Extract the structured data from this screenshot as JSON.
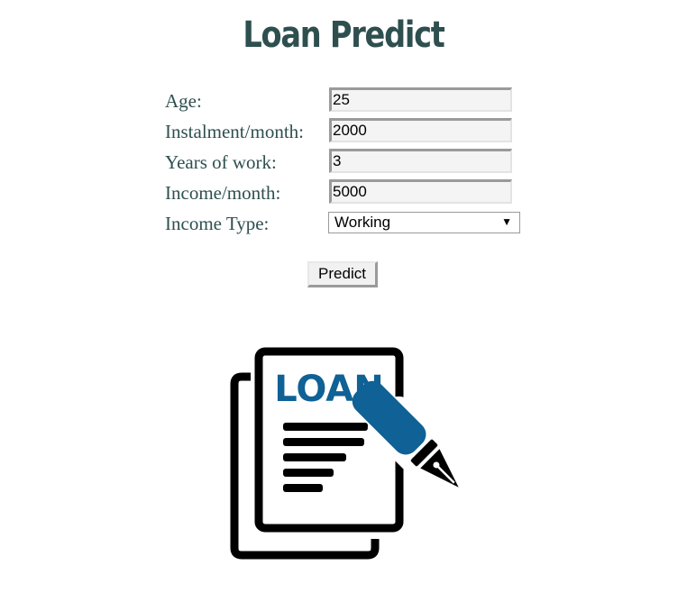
{
  "header": {
    "title": "Loan Predict"
  },
  "form": {
    "fields": [
      {
        "label": "Age:",
        "value": "25"
      },
      {
        "label": "Instalment/month:",
        "value": "2000"
      },
      {
        "label": "Years of work:",
        "value": "3"
      },
      {
        "label": "Income/month:",
        "value": "5000"
      }
    ],
    "income_type": {
      "label": "Income Type:",
      "value": "Working"
    },
    "submit_label": "Predict"
  },
  "illustration": {
    "text": "LOAN",
    "icon": "loan-document-pen-icon",
    "colors": {
      "ink": "#000000",
      "brand": "#0f6196"
    }
  },
  "colors": {
    "title": "#2f4f4f",
    "labels": "#2f4f4f"
  }
}
